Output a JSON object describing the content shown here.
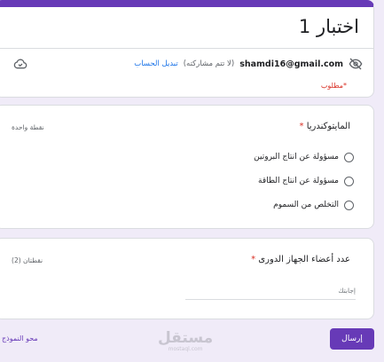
{
  "header": {
    "title": "اختبار 1",
    "email": "shamdi16@gmail.com",
    "not_shared": "(لا تتم مشاركته)",
    "switch_account": "تبديل الحساب",
    "required_note": "*مطلوب",
    "icons": [
      "eye-off-icon",
      "cloud-icon"
    ]
  },
  "questions": [
    {
      "title": "المايتوكندريا",
      "required": "*",
      "points": "نقطة واحدة",
      "options": [
        "مسؤولة عن انتاج البروتين",
        "مسؤولة عن انتاج الطاقة",
        "التخلص من السموم"
      ]
    },
    {
      "title": "عدد أعضاء الجهاز الدورى",
      "required": "*",
      "points": "نقطتان (2)",
      "placeholder": "إجابتك"
    }
  ],
  "footer": {
    "submit_label": "إرسال",
    "clear_label": "محو النموذج"
  },
  "watermark": {
    "arabic": "مستقل",
    "latin": "mostaql.com"
  },
  "colors": {
    "accent": "#673ab7",
    "background": "#f0ebf8",
    "required": "#d93025",
    "link": "#1a73e8"
  }
}
